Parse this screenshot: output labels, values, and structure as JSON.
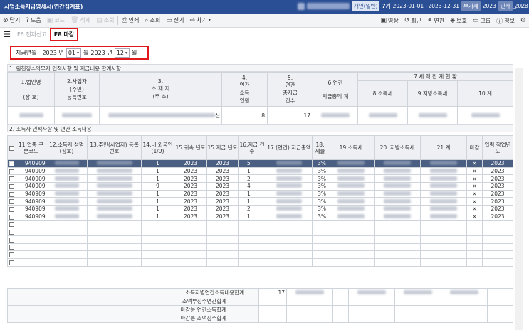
{
  "window": {
    "title": "사업소득지급명세서(연간집계표)",
    "company_type": "개인(일반)",
    "period_badge": "7기",
    "period_range": "2023-01-01~2023-12-31",
    "vat_badge": "부가세",
    "vat_year": "2023",
    "tax_badge": "인사",
    "tax_year": "2023"
  },
  "toolbar": {
    "close": "닫기",
    "help": "도움",
    "code": "코드",
    "delete": "삭제",
    "inquiry": "조회",
    "print": "인쇄",
    "search": "조회",
    "electronic": "전기",
    "etc": "차기",
    "view": "영상",
    "recent": "최근",
    "link": "연관",
    "protect": "보호",
    "group": "그룹",
    "info": "정보"
  },
  "tabs": {
    "f6": "F6 전자신고",
    "f8": "F8 마감"
  },
  "period": {
    "label": "지급년월",
    "from_year": "2023",
    "from_month": "01",
    "to_year": "2023",
    "to_month": "12",
    "year_unit": "년",
    "month_unit": "월"
  },
  "section1": {
    "title": "1. 원천징수의무자 인적사항 및 지급내용 합계사항",
    "headers": {
      "corp": "1.법인명",
      "corp_sub": "(상  호)",
      "reg": "2.사업자",
      "reg_sub1": "(주민)",
      "reg_sub2": "등록번호",
      "addr": "3.",
      "addr_sub1": "소 재 지",
      "addr_sub2": "(주  소)",
      "people": "4.",
      "people_sub1": "연간",
      "people_sub2": "소득",
      "people_sub3": "인원",
      "count": "5.",
      "count_sub1": "연간",
      "count_sub2": "총지급",
      "count_sub3": "건수",
      "total_pay": "6.연간",
      "total_pay_sub": "지급총액 계",
      "group": "7.세 액 집 계 현 황",
      "income_tax": "8.소득세",
      "local_tax": "9.지방소득세",
      "sum": "10.계"
    },
    "row": {
      "addr_tail": "신",
      "people": "8",
      "count": "17"
    }
  },
  "section2": {
    "title": "2. 소득자 인적사항 및 연간 소득내용",
    "headers": {
      "code": "11.업종\n구분코드",
      "name": "12.소득자\n성명(상호)",
      "id": "13.주민(사업자)\n등록번호",
      "foreign": "14.내\n외국인\n(1/9)",
      "year": "15.귀속\n년도",
      "pay_year": "15.지급\n년도",
      "count": "16.지급\n건수",
      "amount": "17.(연간)\n지급총액",
      "rate": "18.\n세율",
      "income_tax": "19.소득세",
      "local_tax": "20.\n지방소득세",
      "sum": "21.계",
      "closed": "마감",
      "input_year": "입력\n작업년도"
    },
    "rows": [
      {
        "code": "940909",
        "foreign": "1",
        "year": "2023",
        "pay_year": "2023",
        "count": "5",
        "rate": "3%",
        "closed": "×",
        "input_year": "2023"
      },
      {
        "code": "940909",
        "foreign": "1",
        "year": "2023",
        "pay_year": "2023",
        "count": "1",
        "rate": "3%",
        "closed": "×",
        "input_year": "2023"
      },
      {
        "code": "940909",
        "foreign": "1",
        "year": "2023",
        "pay_year": "2023",
        "count": "2",
        "rate": "3%",
        "closed": "×",
        "input_year": "2023"
      },
      {
        "code": "940909",
        "foreign": "9",
        "year": "2023",
        "pay_year": "2023",
        "count": "4",
        "rate": "3%",
        "closed": "×",
        "input_year": "2023"
      },
      {
        "code": "940909",
        "foreign": "1",
        "year": "2023",
        "pay_year": "2023",
        "count": "1",
        "rate": "3%",
        "closed": "×",
        "input_year": "2023"
      },
      {
        "code": "940909",
        "foreign": "1",
        "year": "2023",
        "pay_year": "2023",
        "count": "1",
        "rate": "3%",
        "closed": "×",
        "input_year": "2023"
      },
      {
        "code": "940909",
        "foreign": "1",
        "year": "2023",
        "pay_year": "2023",
        "count": "2",
        "rate": "3%",
        "closed": "×",
        "input_year": "2023"
      },
      {
        "code": "940909",
        "foreign": "1",
        "year": "2023",
        "pay_year": "2023",
        "count": "1",
        "rate": "3%",
        "closed": "×",
        "input_year": "2023"
      }
    ],
    "summary": {
      "total_label": "소득자별연간소득내용합계",
      "total_count": "17",
      "small_label": "소액부징수연간합계",
      "closed_income": "마감분 연간소득합계",
      "closed_tax": "마감분 소액징수합계"
    }
  }
}
